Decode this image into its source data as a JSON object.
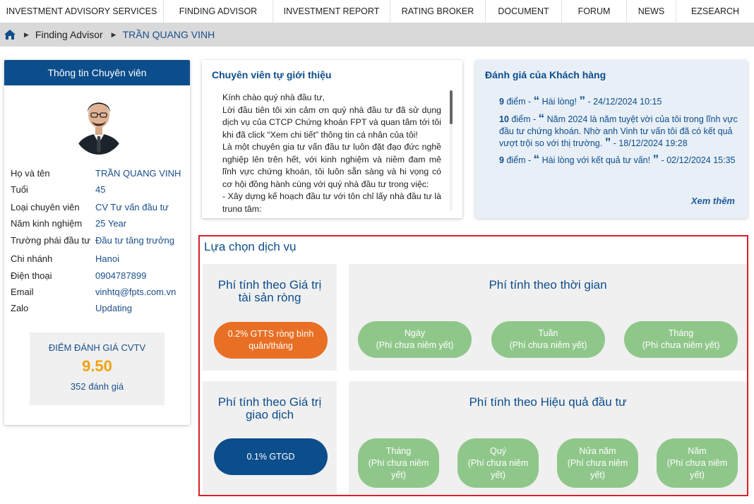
{
  "nav": {
    "items": [
      "INVESTMENT ADVISORY SERVICES",
      "FINDING ADVISOR",
      "INVESTMENT REPORT",
      "RATING BROKER",
      "DOCUMENT",
      "FORUM",
      "NEWS",
      "EZSEARCH"
    ]
  },
  "breadcrumb": {
    "home_icon": "home-icon",
    "level1": "Finding Advisor",
    "current": "TRẦN QUANG VINH"
  },
  "profile": {
    "header": "Thông tin Chuyên viên",
    "fields": [
      {
        "label": "Họ và tên",
        "value": "TRẦN QUANG VINH"
      },
      {
        "label": "Tuổi",
        "value": "45"
      },
      {
        "label": "Loại chuyên viên",
        "value": "CV Tư vấn đầu tư"
      },
      {
        "label": "Năm kinh nghiệm",
        "value": "25 Year"
      },
      {
        "label": "Trường phái đầu tư",
        "value": "Đầu tư tăng trưởng"
      },
      {
        "label": "Chi nhánh",
        "value": "Hanoi"
      },
      {
        "label": "Điện thoại",
        "value": "0904787899"
      },
      {
        "label": "Email",
        "value": "vinhtq@fpts.com.vn"
      },
      {
        "label": "Zalo",
        "value": "Updating"
      }
    ],
    "score_title": "ĐIỂM ĐÁNH GIÁ CVTV",
    "score": "9.50",
    "review_count": "352 đánh giá"
  },
  "intro": {
    "title": "Chuyên viên tự giới thiệu",
    "paragraphs": [
      "Kính chào quý nhà đầu tư,",
      "Lời đầu tiên tôi xin cảm ơn quý nhà đầu tư đã sử dụng dịch vụ của CTCP Chứng khoán FPT và quan tâm tới tôi khi đã click “Xem chi tiết” thông tin cá nhân của tôi!",
      "Là một chuyên gia tư vấn đầu tư luôn đặt đạo đức nghề nghiệp lên trên hết, với kinh nghiệm và niềm đam mê lĩnh vực chứng khoán, tôi luôn sẵn sàng và hi vọng có cơ hội đồng hành cùng với quý nhà đầu tư trong việc:",
      "- Xây dựng kế hoạch đầu tư với tôn chỉ lấy nhà đầu tư là trung tâm;"
    ]
  },
  "reviews": {
    "title": "Đánh giá của Khách hàng",
    "items": [
      {
        "score": "9",
        "unit": "điểm -",
        "open": "“",
        "text": "Hài lòng!",
        "close": "”",
        "date": "- 24/12/2024 10:15"
      },
      {
        "score": "10",
        "unit": "điểm -",
        "open": "“",
        "text": "Năm 2024 là năm tuyệt vời của tôi trong lĩnh vực đầu tư chứng khoán. Nhờ anh Vinh tư vấn tôi đã có kết quả vượt trội so với thị trường.",
        "close": "”",
        "date": "- 18/12/2024 19:28"
      },
      {
        "score": "9",
        "unit": "điểm -",
        "open": "“",
        "text": "Hài lòng với kết quả tư vấn!",
        "close": "”",
        "date": "- 02/12/2024 15:35"
      }
    ],
    "more": "Xem thêm"
  },
  "services": {
    "title": "Lựa chọn dịch vụ",
    "nav_asset": {
      "title": "Phí tính theo Giá trị tài sản ròng",
      "button": "0.2% GTTS ròng bình quân/tháng"
    },
    "time": {
      "title": "Phí tính theo thời gian",
      "options": [
        {
          "label": "Ngày",
          "note": "(Phí chưa niêm yết)"
        },
        {
          "label": "Tuần",
          "note": "(Phí chưa niêm yết)"
        },
        {
          "label": "Tháng",
          "note": "(Phí chưa niêm yết)"
        }
      ]
    },
    "transaction": {
      "title": "Phí tính theo Giá trị giao dịch",
      "button": "0.1% GTGD"
    },
    "performance": {
      "title": "Phí tính theo Hiệu quả đầu tư",
      "options": [
        {
          "label": "Tháng",
          "note": "(Phí chưa niêm yết)"
        },
        {
          "label": "Quý",
          "note": "(Phí chưa niêm yết)"
        },
        {
          "label": "Nửa năm",
          "note": "(Phí chưa niêm yết)"
        },
        {
          "label": "Năm",
          "note": "(Phí chưa niêm yết)"
        }
      ]
    }
  },
  "colors": {
    "primary": "#0c4d8c",
    "accent_orange": "#e86f24",
    "score_gold": "#f1a20f",
    "option_green": "#8fc78a",
    "border_red": "#d8202a"
  }
}
